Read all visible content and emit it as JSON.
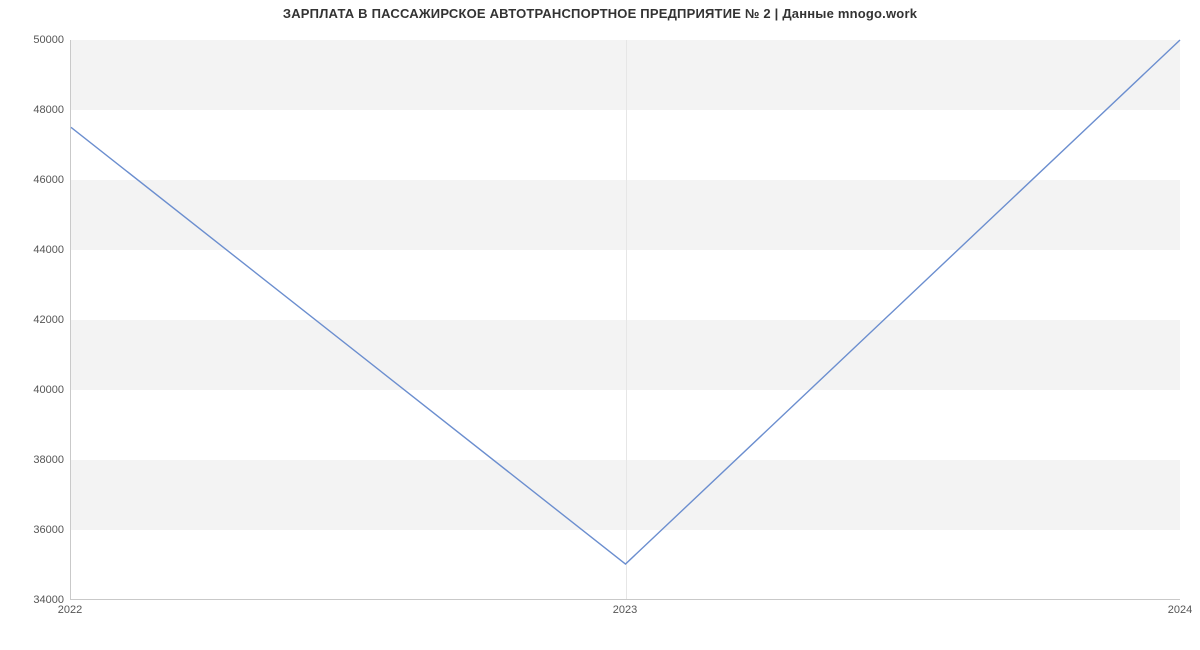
{
  "chart_data": {
    "type": "line",
    "title": "ЗАРПЛАТА В  ПАССАЖИРСКОЕ АВТОТРАНСПОРТНОЕ ПРЕДПРИЯТИЕ № 2 | Данные mnogo.work",
    "x": [
      "2022",
      "2023",
      "2024"
    ],
    "values": [
      47500,
      35000,
      50000
    ],
    "xlabel": "",
    "ylabel": "",
    "ylim": [
      34000,
      50000
    ],
    "yticks": [
      34000,
      36000,
      38000,
      40000,
      42000,
      44000,
      46000,
      48000,
      50000
    ],
    "xticks": [
      "2022",
      "2023",
      "2024"
    ],
    "grid": true,
    "colors": {
      "line": "#6b8ecf",
      "band": "#f3f3f3"
    }
  }
}
